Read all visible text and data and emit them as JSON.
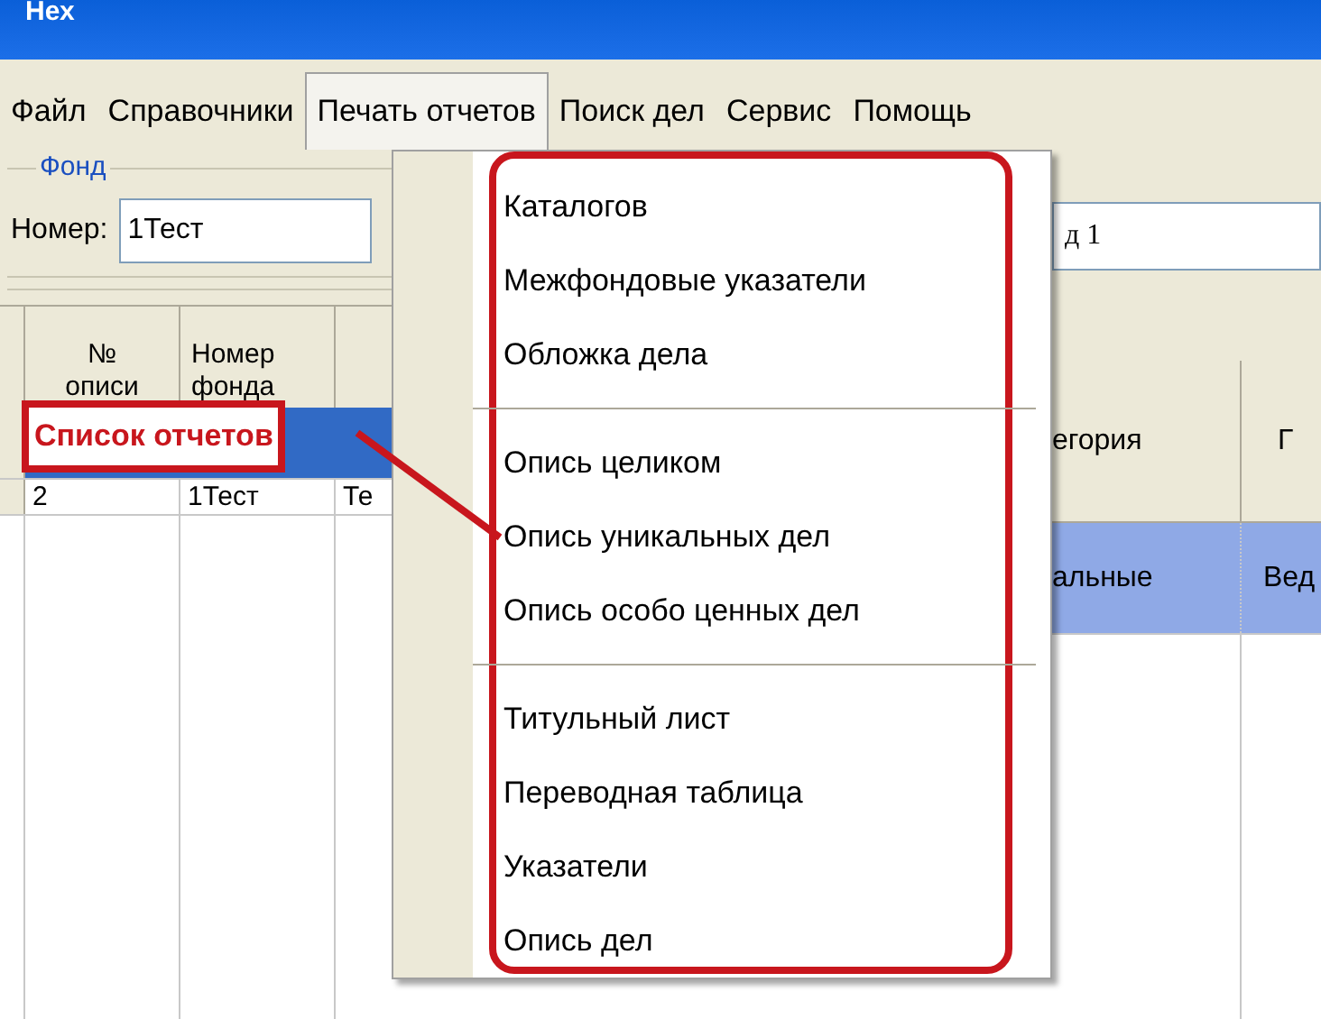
{
  "window": {
    "title": "Нех"
  },
  "menu_bar": [
    {
      "label": "Файл",
      "selected": false
    },
    {
      "label": "Справочники",
      "selected": false
    },
    {
      "label": "Печать отчетов",
      "selected": true
    },
    {
      "label": "Поиск дел",
      "selected": false
    },
    {
      "label": "Сервис",
      "selected": false
    },
    {
      "label": "Помощь",
      "selected": false
    }
  ],
  "open_menu": {
    "items": [
      {
        "kind": "item",
        "label": "Каталогов"
      },
      {
        "kind": "item",
        "label": "Межфондовые указатели"
      },
      {
        "kind": "item",
        "label": "Обложка дела"
      },
      {
        "kind": "separator"
      },
      {
        "kind": "item",
        "label": "Опись целиком"
      },
      {
        "kind": "item",
        "label": "Опись уникальных дел"
      },
      {
        "kind": "item",
        "label": "Опись особо ценных дел"
      },
      {
        "kind": "separator"
      },
      {
        "kind": "item",
        "label": "Титульный лист"
      },
      {
        "kind": "item",
        "label": "Переводная таблица"
      },
      {
        "kind": "item",
        "label": "Указатели"
      },
      {
        "kind": "item",
        "label": "Опись дел"
      }
    ]
  },
  "fund_group": {
    "title": "Фонд",
    "number_label": "Номер:",
    "number_value": "1Тест",
    "field_2_value": "д 1"
  },
  "inventory_table": {
    "columns": [
      "№ описи",
      "Номер фонда"
    ],
    "rows": [
      {
        "selected": true
      },
      {
        "selected": false,
        "cells": [
          "2",
          "1Тест",
          "Те"
        ]
      }
    ]
  },
  "detail_table": {
    "columns": [
      "егория",
      "Г"
    ],
    "rows": [
      {
        "selected": true,
        "cells": [
          "альные",
          "Вед"
        ]
      }
    ]
  },
  "annotation": {
    "label": "Список отчетов"
  }
}
